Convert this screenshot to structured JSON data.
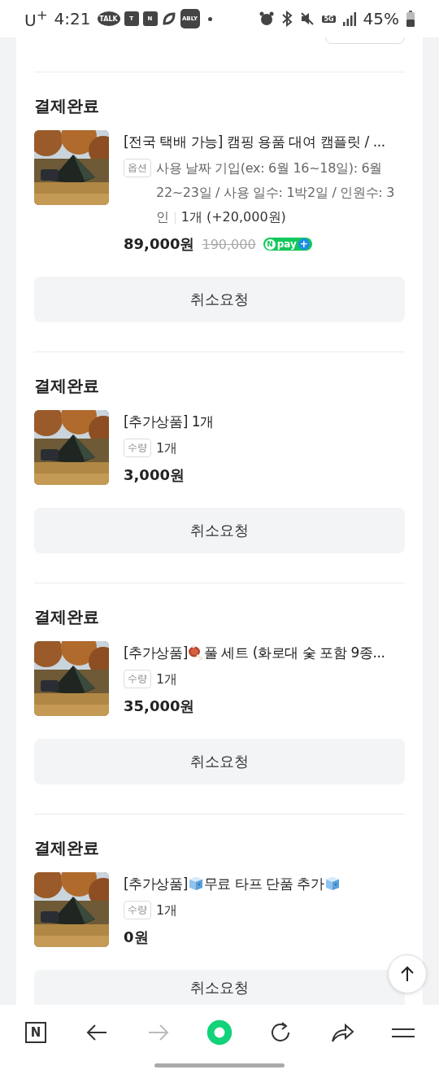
{
  "status_bar": {
    "carrier": "U$^{+}$",
    "time": "4:21",
    "app_icons": [
      {
        "kind": "talk",
        "text": "TALK"
      },
      {
        "kind": "teams",
        "text": "T"
      },
      {
        "kind": "naver",
        "text": "N"
      },
      {
        "kind": "leaf"
      },
      {
        "kind": "ably",
        "text": "ABLY"
      }
    ],
    "network": "5G",
    "battery": "45%"
  },
  "orders": [
    {
      "status": "결제완료",
      "title_parts": [
        {
          "kind": "text",
          "text": "[전국 택배 가능] 캠핑 용품 대여 캠플릿 / ..."
        }
      ],
      "option_label": "옵션",
      "option_text": "사용 날짜 기입(ex: 6월 16~18일): 6월 22~23일 / 사용 일수: 1박2일 / 인원수: 3인",
      "quantity": "1개 (+20,000원)",
      "price": "89,000원",
      "original_price": "190,000",
      "pay_badge": {
        "mark": "N",
        "label": "pay",
        "plus": "+"
      },
      "button": "취소요청"
    },
    {
      "status": "결제완료",
      "title_parts": [
        {
          "kind": "text",
          "text": "[추가상품] 1개"
        }
      ],
      "option_label": "수량",
      "quantity": "1개",
      "price": "3,000원",
      "button": "취소요청"
    },
    {
      "status": "결제완료",
      "title_parts": [
        {
          "kind": "text",
          "text": "[추가상품] "
        },
        {
          "kind": "meat"
        },
        {
          "kind": "text",
          "text": "풀 세트 (화로대 숯 포함 9종..."
        }
      ],
      "option_label": "수량",
      "quantity": "1개",
      "price": "35,000원",
      "button": "취소요청"
    },
    {
      "status": "결제완료",
      "title_parts": [
        {
          "kind": "text",
          "text": "[추가상품] "
        },
        {
          "kind": "ice"
        },
        {
          "kind": "text",
          "text": "무료 타프 단품 추가 "
        },
        {
          "kind": "ice"
        }
      ],
      "option_label": "수량",
      "quantity": "1개",
      "price": "0원",
      "button": "취소요청"
    }
  ],
  "bottom_nav": {
    "home_mark": "N"
  }
}
